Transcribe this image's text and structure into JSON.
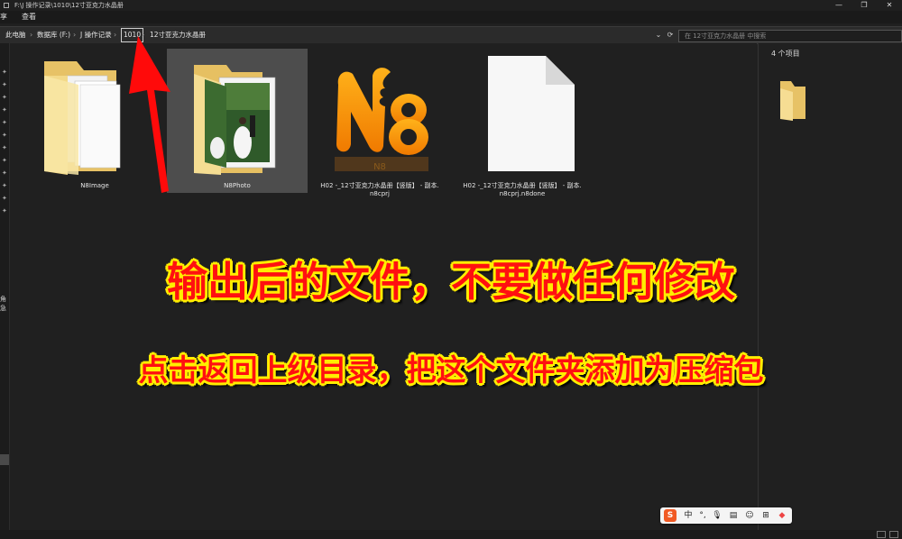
{
  "window": {
    "title": "F:\\J 操作记录\\1010\\12寸亚克力水晶册",
    "controls": {
      "minimize": "—",
      "maximize": "❐",
      "close": "✕"
    }
  },
  "menu": {
    "left_label": "享",
    "view_label": "查看"
  },
  "breadcrumb": {
    "items": [
      "此电脑",
      "数据库 (F:)",
      "J 操作记录",
      "1010",
      "12寸亚克力水晶册"
    ],
    "separator": "›",
    "active_index": 3
  },
  "address_buttons": {
    "dropdown": "⌄",
    "refresh": "⟳"
  },
  "search": {
    "placeholder": "在 12寸亚克力水晶册 中搜索"
  },
  "files": [
    {
      "name": "N8Image",
      "type": "folder-docs",
      "selected": false
    },
    {
      "name": "N8Photo",
      "type": "folder-photo",
      "selected": true
    },
    {
      "name": "H02 -_12寸亚克力水晶册【竖版】 - 副本.n8cprj",
      "line1": "H02 -_12寸亚克力水晶册【竖版】 - 副本.",
      "line2": "n8cprj",
      "type": "n8-logo"
    },
    {
      "name": "H02 -_12寸亚克力水晶册【竖版】 - 副本.n8cprj.n8done",
      "line1": "H02 -_12寸亚克力水晶册【竖版】 - 副本.",
      "line2": "n8cprj.n8done",
      "type": "blank-file"
    }
  ],
  "details": {
    "count": "4 个项目"
  },
  "nav": {
    "cut_text": "角急"
  },
  "overlay": {
    "line1": "输出后的文件，不要做任何修改",
    "line2": "点击返回上级目录，把这个文件夹添加为压缩包",
    "fill_color": "#ff1010",
    "stroke_color": "#ffee00"
  },
  "logo_text": "N8",
  "ime": {
    "brand": "S",
    "mode": "中",
    "punct": "°,",
    "voice": "🎙",
    "keyboard": "▤",
    "grid": "⊞",
    "emoji": "☺"
  },
  "colors": {
    "background": "#202020",
    "selection": "#4d4d4d",
    "arrow": "#ff0a0a"
  }
}
